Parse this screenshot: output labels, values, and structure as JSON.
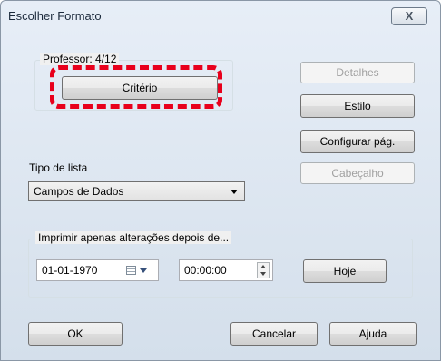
{
  "window": {
    "title": "Escolher Formato",
    "close_glyph": "X"
  },
  "professor_group": {
    "legend": "Professor: 4/12",
    "criterio_label": "Critério"
  },
  "right_buttons": {
    "detalhes": "Detalhes",
    "estilo": "Estilo",
    "configurar": "Configurar pág.",
    "cabecalho": "Cabeçalho"
  },
  "tipo_lista": {
    "label": "Tipo de lista",
    "selected": "Campos de Dados"
  },
  "print_group": {
    "legend": "Imprimir apenas alterações depois de...",
    "date": "01-01-1970",
    "time": "00:00:00",
    "hoje": "Hoje"
  },
  "footer": {
    "ok": "OK",
    "cancelar": "Cancelar",
    "ajuda": "Ajuda"
  },
  "colors": {
    "highlight": "#e8001c"
  }
}
